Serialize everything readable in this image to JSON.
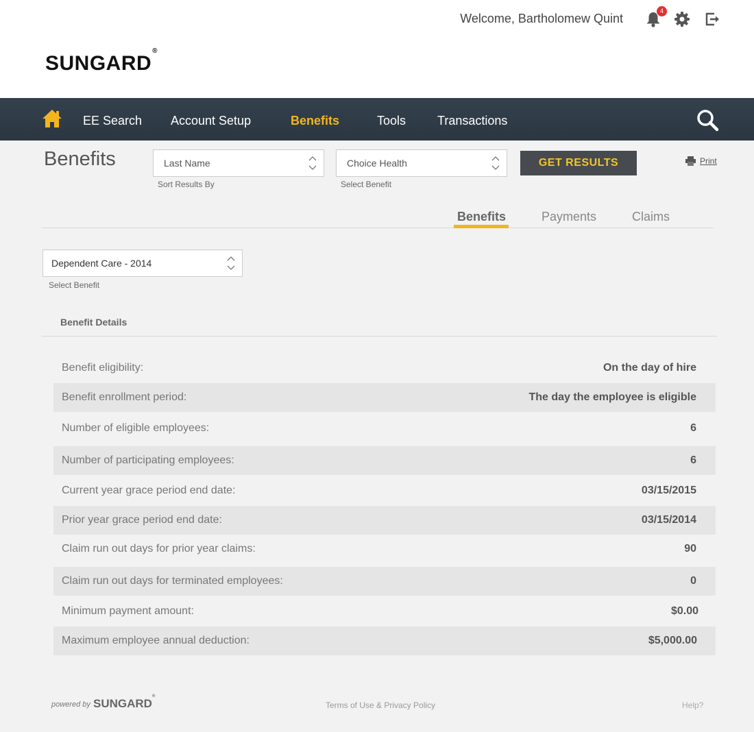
{
  "header": {
    "welcome": "Welcome, Bartholomew Quint",
    "notification_count": "4",
    "logo": "SUNGARD"
  },
  "nav": {
    "items": [
      {
        "label": "EE Search"
      },
      {
        "label": "Account Setup"
      },
      {
        "label": "Benefits"
      },
      {
        "label": "Tools"
      },
      {
        "label": "Transactions"
      }
    ],
    "active": "Benefits"
  },
  "page": {
    "title": "Benefits",
    "sort_select": {
      "value": "Last Name",
      "label": "Sort Results By"
    },
    "benefit_select": {
      "value": "Choice Health",
      "label": "Select Benefit"
    },
    "get_results": "GET RESULTS",
    "print": "Print"
  },
  "tabs": [
    {
      "label": "Benefits"
    },
    {
      "label": "Payments"
    },
    {
      "label": "Claims"
    }
  ],
  "details": {
    "benefit_select": {
      "value": "Dependent Care - 2014",
      "label": "Select Benefit"
    },
    "section_title": "Benefit Details",
    "rows": [
      {
        "label": "Benefit eligibility:",
        "value": "On the day of hire"
      },
      {
        "label": "Benefit enrollment period:",
        "value": "The day the employee is eligible"
      },
      {
        "label": "Number of eligible employees:",
        "value": "6"
      },
      {
        "label": "Number of participating employees:",
        "value": "6"
      },
      {
        "label": "Current year grace period end date:",
        "value": "03/15/2015"
      },
      {
        "label": "Prior year grace period end date:",
        "value": "03/15/2014"
      },
      {
        "label": "Claim run out days for prior year claims:",
        "value": "90"
      },
      {
        "label": "Claim run out days for terminated employees:",
        "value": "0"
      },
      {
        "label": "Minimum payment amount:",
        "value": "$0.00"
      },
      {
        "label": "Maximum employee annual deduction:",
        "value": "$5,000.00"
      }
    ]
  },
  "footer": {
    "powered_by": "powered by",
    "logo": "SUNGARD",
    "terms": "Terms of Use & Privacy Policy",
    "help": "Help?"
  },
  "colors": {
    "accent": "#f3b51e",
    "nav_bg": "#2f3a45",
    "button_bg": "#474b50"
  }
}
